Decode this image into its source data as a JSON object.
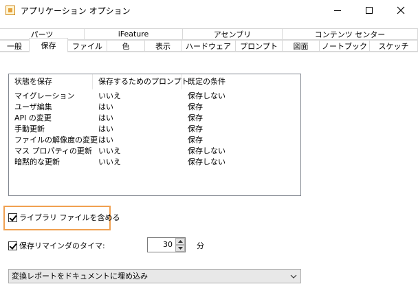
{
  "window": {
    "title": "アプリケーション オプション"
  },
  "tabs_row1": [
    {
      "label": "パーツ"
    },
    {
      "label": "iFeature"
    },
    {
      "label": "アセンブリ"
    },
    {
      "label": "コンテンツ センター"
    }
  ],
  "tabs_row2": [
    {
      "label": "一般"
    },
    {
      "label": "保存",
      "active": true
    },
    {
      "label": "ファイル"
    },
    {
      "label": "色"
    },
    {
      "label": "表示"
    },
    {
      "label": "ハードウェア"
    },
    {
      "label": "プロンプト"
    },
    {
      "label": "図面"
    },
    {
      "label": "ノートブック"
    },
    {
      "label": "スケッチ"
    }
  ],
  "list": {
    "columns": [
      "状態を保存",
      "保存するためのプロンプト",
      "既定の条件"
    ],
    "rows": [
      [
        "マイグレーション",
        "いいえ",
        "保存しない"
      ],
      [
        "ユーザ編集",
        "はい",
        "保存"
      ],
      [
        "API の変更",
        "はい",
        "保存"
      ],
      [
        "手動更新",
        "はい",
        "保存"
      ],
      [
        "ファイルの解像度の変更",
        "はい",
        "保存"
      ],
      [
        "マス プロパティの更新",
        "いいえ",
        "保存しない"
      ],
      [
        "暗黙的な更新",
        "いいえ",
        "保存しない"
      ]
    ]
  },
  "options": {
    "include_library_label": "ライブラリ ファイルを含める",
    "include_library_checked": true,
    "reminder_label": "保存リマインダのタイマ:",
    "reminder_checked": true,
    "reminder_value": "30",
    "reminder_unit": "分",
    "conversion_report": "変換レポートをドキュメントに埋め込み"
  },
  "colors": {
    "highlight": "#f0a050",
    "tab_border": "#d9d9d9"
  }
}
